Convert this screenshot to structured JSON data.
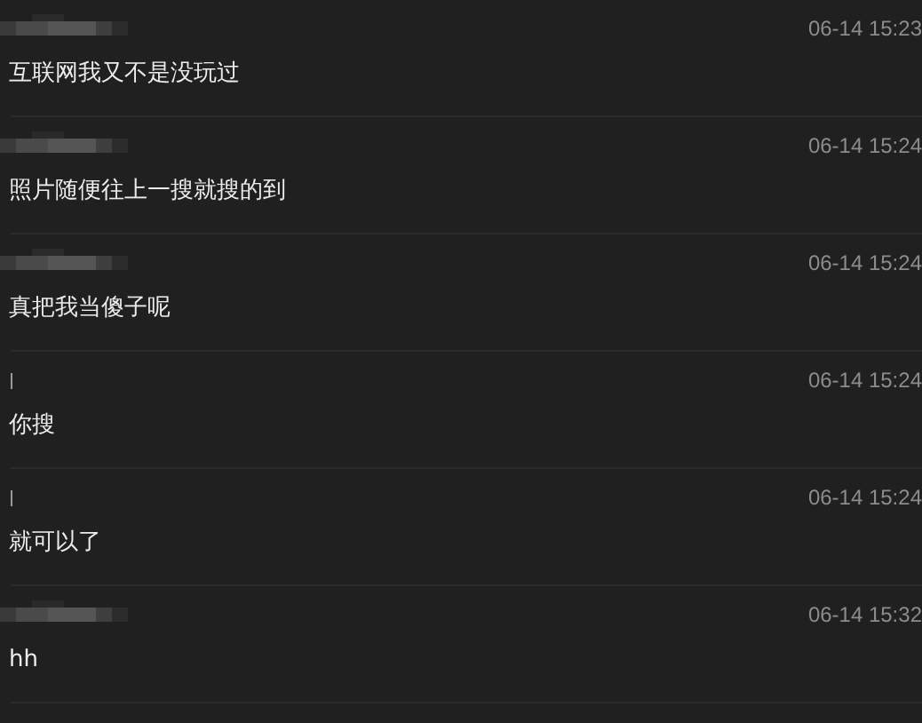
{
  "messages": [
    {
      "kind": "blurred",
      "time": "06-14 15:23",
      "text": "互联网我又不是没玩过"
    },
    {
      "kind": "blurred",
      "time": "06-14 15:24",
      "text": "照片随便往上一搜就搜的到"
    },
    {
      "kind": "blurred",
      "time": "06-14 15:24",
      "text": "真把我当傻子呢"
    },
    {
      "kind": "bar",
      "time": "06-14 15:24",
      "text": "你搜"
    },
    {
      "kind": "bar",
      "time": "06-14 15:24",
      "text": "就可以了"
    },
    {
      "kind": "blurred",
      "time": "06-14 15:32",
      "text": "hh"
    }
  ]
}
